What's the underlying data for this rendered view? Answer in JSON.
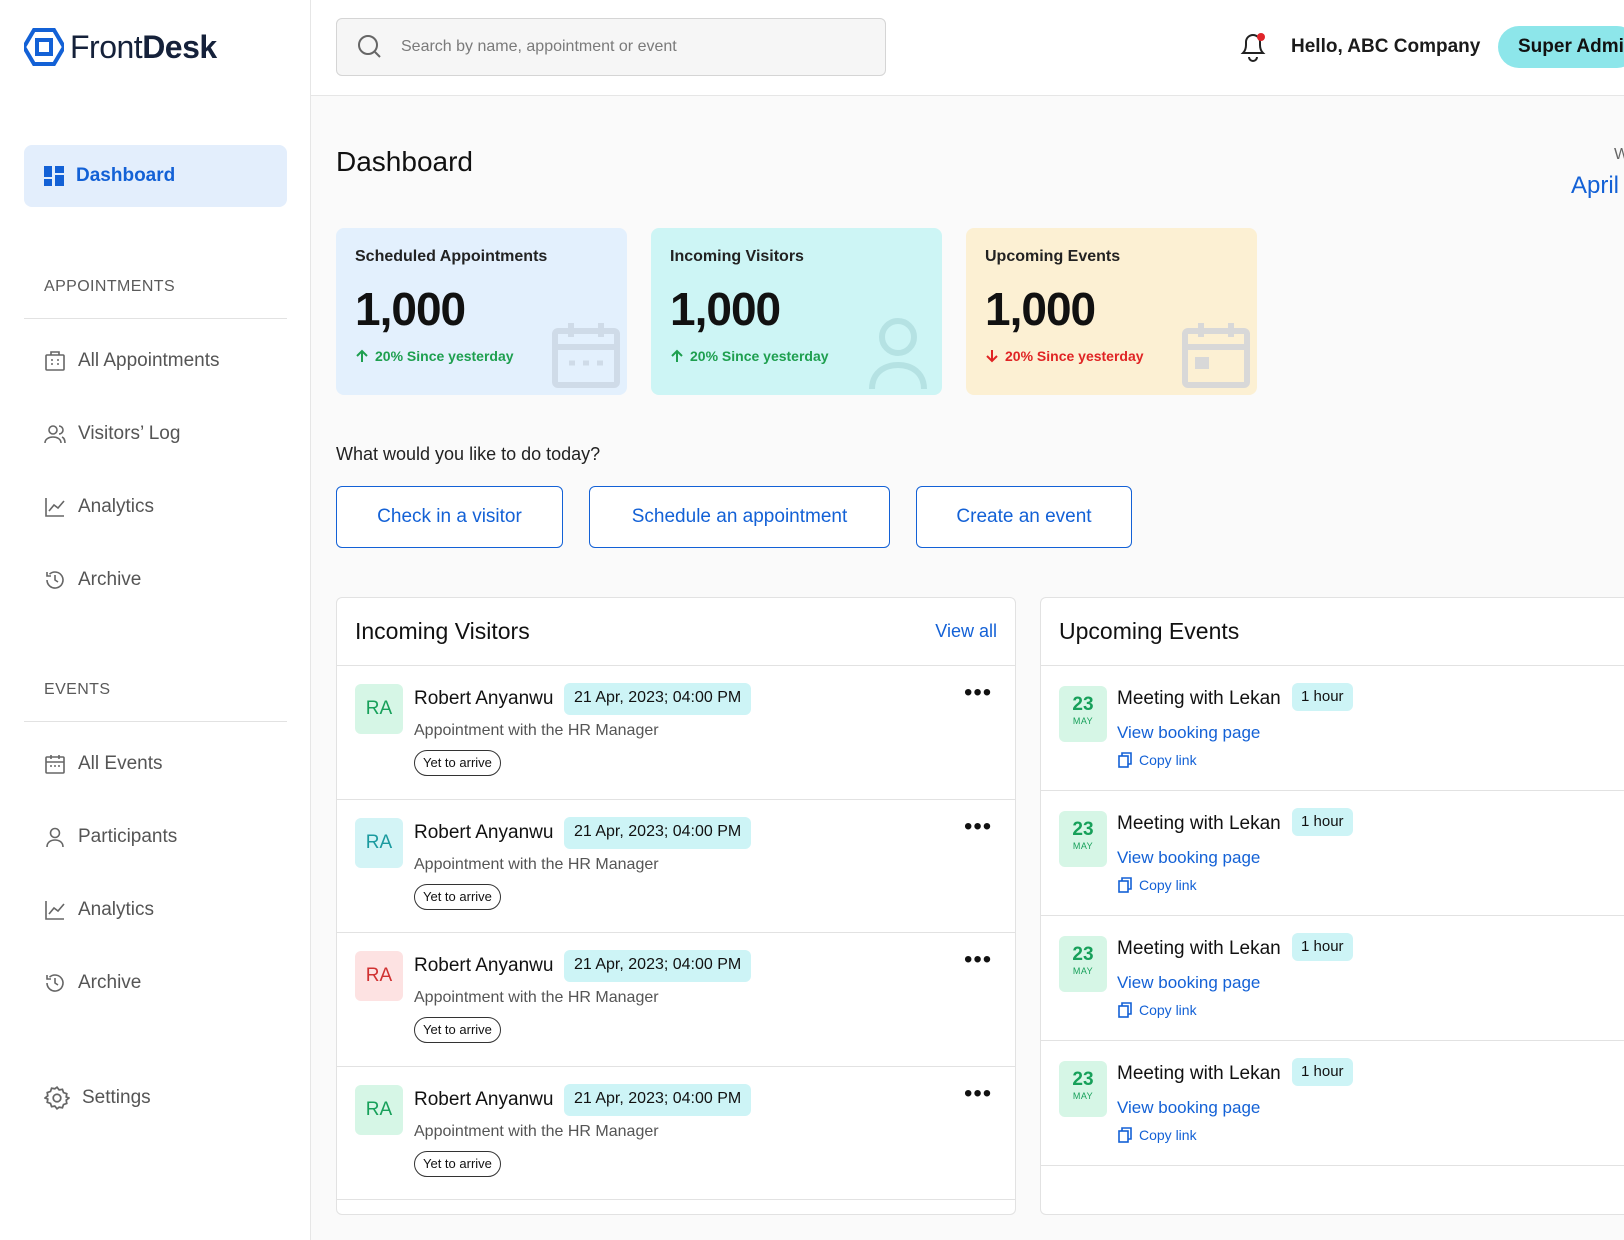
{
  "app": {
    "logo_light": "Front",
    "logo_bold": "Desk"
  },
  "sidebar": {
    "active": {
      "label": "Dashboard",
      "icon": "dashboard-icon"
    },
    "sections": [
      {
        "title": "APPOINTMENTS",
        "items": [
          {
            "label": "All Appointments",
            "icon": "building-icon"
          },
          {
            "label": "Visitors’ Log",
            "icon": "users-icon"
          },
          {
            "label": "Analytics",
            "icon": "chart-icon"
          },
          {
            "label": "Archive",
            "icon": "history-icon"
          }
        ]
      },
      {
        "title": "EVENTS",
        "items": [
          {
            "label": "All Events",
            "icon": "calendar-icon"
          },
          {
            "label": "Participants",
            "icon": "user-icon"
          },
          {
            "label": "Analytics",
            "icon": "chart-icon"
          },
          {
            "label": "Archive",
            "icon": "history-icon"
          }
        ]
      }
    ],
    "settings": {
      "label": "Settings",
      "icon": "gear-icon"
    }
  },
  "header": {
    "search_placeholder": "Search by name, appointment or event",
    "greeting": "Hello, ABC Company",
    "role": "Super Admin"
  },
  "main": {
    "title": "Dashboard",
    "week_label": "W",
    "week_value": "April",
    "stats": [
      {
        "label": "Scheduled Appointments",
        "value": "1,000",
        "delta": "20% Since yesterday",
        "direction": "up",
        "bg": "#e3f0fd",
        "delta_color": "#1e9f4f"
      },
      {
        "label": "Incoming Visitors",
        "value": "1,000",
        "delta": "20% Since yesterday",
        "direction": "up",
        "bg": "#cdf5f5",
        "delta_color": "#1e9f4f"
      },
      {
        "label": "Upcoming Events",
        "value": "1,000",
        "delta": "20% Since yesterday",
        "direction": "down",
        "bg": "#fcf0d3",
        "delta_color": "#e02424"
      }
    ],
    "prompt": "What would you like to do today?",
    "actions": [
      "Check in a visitor",
      "Schedule an appointment",
      "Create an event"
    ],
    "visitors": {
      "title": "Incoming Visitors",
      "view_all": "View all",
      "rows": [
        {
          "initials": "RA",
          "name": "Robert Anyanwu",
          "datetime": "21 Apr, 2023; 04:00 PM",
          "desc": "Appointment with the HR Manager",
          "status": "Yet to arrive",
          "avatar_bg": "#d6f6e6",
          "avatar_fg": "#17a05a"
        },
        {
          "initials": "RA",
          "name": "Robert Anyanwu",
          "datetime": "21 Apr, 2023; 04:00 PM",
          "desc": "Appointment with the HR Manager",
          "status": "Yet to arrive",
          "avatar_bg": "#d3f4f6",
          "avatar_fg": "#1a9a9f"
        },
        {
          "initials": "RA",
          "name": "Robert Anyanwu",
          "datetime": "21 Apr, 2023; 04:00 PM",
          "desc": "Appointment with the HR Manager",
          "status": "Yet to arrive",
          "avatar_bg": "#fde2e2",
          "avatar_fg": "#d03131"
        },
        {
          "initials": "RA",
          "name": "Robert Anyanwu",
          "datetime": "21 Apr, 2023; 04:00 PM",
          "desc": "Appointment with the HR Manager",
          "status": "Yet to arrive",
          "avatar_bg": "#d6f6e6",
          "avatar_fg": "#17a05a"
        }
      ]
    },
    "events": {
      "title": "Upcoming Events",
      "rows": [
        {
          "day": "23",
          "month": "MAY",
          "title": "Meeting with Lekan",
          "duration": "1 hour",
          "link": "View booking page",
          "copy": "Copy link"
        },
        {
          "day": "23",
          "month": "MAY",
          "title": "Meeting with Lekan",
          "duration": "1 hour",
          "link": "View booking page",
          "copy": "Copy link"
        },
        {
          "day": "23",
          "month": "MAY",
          "title": "Meeting with Lekan",
          "duration": "1 hour",
          "link": "View booking page",
          "copy": "Copy link"
        },
        {
          "day": "23",
          "month": "MAY",
          "title": "Meeting with Lekan",
          "duration": "1 hour",
          "link": "View booking page",
          "copy": "Copy link"
        }
      ]
    }
  }
}
